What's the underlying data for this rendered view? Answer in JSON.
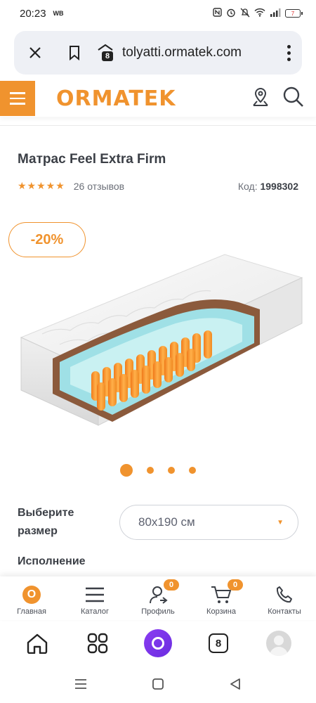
{
  "status": {
    "time": "20:23",
    "carrier": "WB",
    "battery": "7"
  },
  "browser": {
    "url": "tolyatti.ormatek.com",
    "tab_count": "8"
  },
  "site": {
    "logo": "ORMATEK",
    "accent_color": "#f0932e"
  },
  "product": {
    "title": "Матрас Feel Extra Firm",
    "stars": "★★★★★",
    "reviews": "26 отзывов",
    "code_label": "Код:",
    "code_value": "1998302",
    "discount": "-20%",
    "carousel": {
      "count": 4,
      "active": 1
    }
  },
  "size": {
    "label": "Выберите размер",
    "value": "80х190 см"
  },
  "execution_label": "Исполнение",
  "site_nav": {
    "items": [
      {
        "label": "Главная",
        "icon": "home-logo-icon",
        "glyph": "O"
      },
      {
        "label": "Каталог",
        "icon": "catalog-icon"
      },
      {
        "label": "Профиль",
        "icon": "profile-icon",
        "badge": "0"
      },
      {
        "label": "Корзина",
        "icon": "cart-icon",
        "badge": "0"
      },
      {
        "label": "Контакты",
        "icon": "phone-icon"
      }
    ]
  },
  "browser_toolbar": {
    "tab_count": "8"
  }
}
